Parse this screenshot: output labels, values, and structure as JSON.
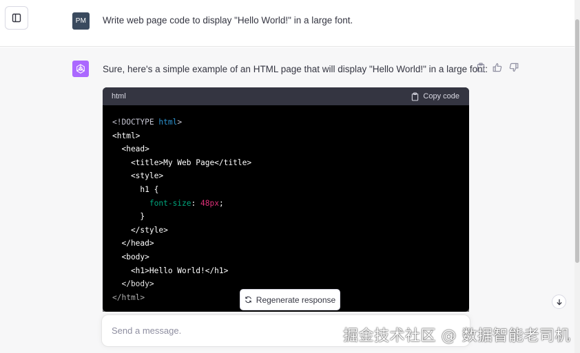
{
  "conversation": {
    "user": {
      "avatar_initials": "PM",
      "message": "Write web page code to display \"Hello World!\" in a large font."
    },
    "assistant": {
      "message": "Sure, here's a simple example of an HTML page that will display \"Hello World!\" in a large font:",
      "code_block": {
        "language": "html",
        "copy_label": "Copy code",
        "lines": [
          "<!DOCTYPE html>",
          "<html>",
          "  <head>",
          "    <title>My Web Page</title>",
          "    <style>",
          "      h1 {",
          "        font-size: 48px;",
          "      }",
          "    </style>",
          "  </head>",
          "  <body>",
          "    <h1>Hello World!</h1>",
          "  </body>",
          "</html>"
        ]
      }
    }
  },
  "controls": {
    "regenerate_label": "Regenerate response",
    "input_placeholder": "Send a message."
  },
  "icons": {
    "sidebar_toggle": "sidebar-toggle-icon",
    "copy": "clipboard-icon",
    "thumbs_up": "thumbs-up-icon",
    "thumbs_down": "thumbs-down-icon",
    "regenerate": "refresh-icon",
    "scroll_down": "arrow-down-icon"
  },
  "colors": {
    "assistant_avatar": "#ab68ff",
    "user_avatar": "#3a4a5e",
    "code_keyword": "#2e95d3",
    "code_property": "#00a67d",
    "code_number": "#df3079"
  },
  "watermark": "掘金技术社区 @ 数据智能老司机"
}
